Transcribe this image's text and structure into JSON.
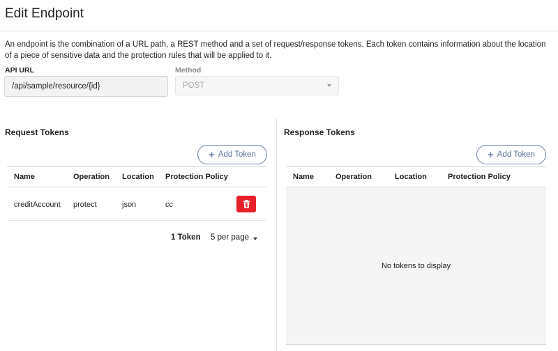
{
  "page": {
    "title": "Edit Endpoint",
    "description": "An endpoint is the combination of a URL path, a REST method and a set of request/response tokens. Each token contains information about the location of a piece of sensitive data and the protection rules that will be applied to it."
  },
  "form": {
    "api_url_label": "API URL",
    "api_url_value": "/api/sample/resource/{id}",
    "method_label": "Method",
    "method_value": "POST"
  },
  "request_tokens": {
    "title": "Request Tokens",
    "add_label": "Add Token",
    "columns": [
      "Name",
      "Operation",
      "Location",
      "Protection Policy"
    ],
    "rows": [
      {
        "name": "creditAccount",
        "operation": "protect",
        "location": "json",
        "policy": "cc"
      }
    ],
    "pager": {
      "count_label": "1 Token",
      "per_page_label": "5 per page"
    }
  },
  "response_tokens": {
    "title": "Response Tokens",
    "add_label": "Add Token",
    "columns": [
      "Name",
      "Operation",
      "Location",
      "Protection Policy"
    ],
    "empty_message": "No tokens to display"
  },
  "icons": {
    "add": "plus-icon",
    "delete": "trash-icon",
    "dropdown": "chevron-down-icon"
  },
  "colors": {
    "accent": "#6d86a6",
    "danger": "#e8202a",
    "empty_bg": "#f5f5f5"
  }
}
